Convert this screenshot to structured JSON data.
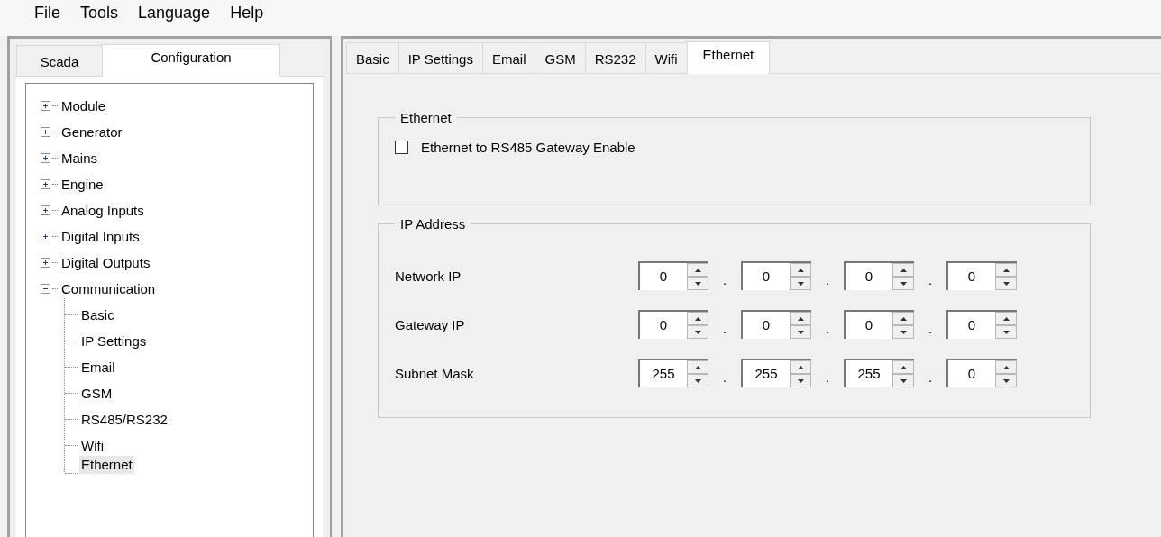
{
  "menu": [
    "File",
    "Tools",
    "Language",
    "Help"
  ],
  "left_tabs": [
    {
      "label": "Scada",
      "selected": false
    },
    {
      "label": "Configuration",
      "selected": true
    }
  ],
  "tree": [
    {
      "label": "Module",
      "expanded": false
    },
    {
      "label": "Generator",
      "expanded": false
    },
    {
      "label": "Mains",
      "expanded": false
    },
    {
      "label": "Engine",
      "expanded": false
    },
    {
      "label": "Analog Inputs",
      "expanded": false
    },
    {
      "label": "Digital Inputs",
      "expanded": false
    },
    {
      "label": "Digital Outputs",
      "expanded": false
    },
    {
      "label": "Communication",
      "expanded": true,
      "children": [
        {
          "label": "Basic",
          "selected": false
        },
        {
          "label": "IP Settings",
          "selected": false
        },
        {
          "label": "Email",
          "selected": false
        },
        {
          "label": "GSM",
          "selected": false
        },
        {
          "label": "RS485/RS232",
          "selected": false
        },
        {
          "label": "Wifi",
          "selected": false
        },
        {
          "label": "Ethernet",
          "selected": true
        }
      ]
    }
  ],
  "right_tabs": [
    {
      "label": "Basic",
      "selected": false
    },
    {
      "label": "IP Settings",
      "selected": false
    },
    {
      "label": "Email",
      "selected": false
    },
    {
      "label": "GSM",
      "selected": false
    },
    {
      "label": "RS232",
      "selected": false
    },
    {
      "label": "Wifi",
      "selected": false
    },
    {
      "label": "Ethernet",
      "selected": true
    }
  ],
  "ethernet_group": {
    "title": "Ethernet",
    "checkbox": {
      "label": "Ethernet to RS485 Gateway Enable",
      "checked": false
    }
  },
  "ip_group": {
    "title": "IP Address",
    "rows": [
      {
        "label": "Network IP",
        "octets": [
          "0",
          "0",
          "0",
          "0"
        ],
        "separator": "."
      },
      {
        "label": "Gateway IP",
        "octets": [
          "0",
          "0",
          "0",
          "0"
        ],
        "separator": "."
      },
      {
        "label": "Subnet Mask",
        "octets": [
          "255",
          "255",
          "255",
          "0"
        ],
        "separator": "."
      }
    ]
  }
}
